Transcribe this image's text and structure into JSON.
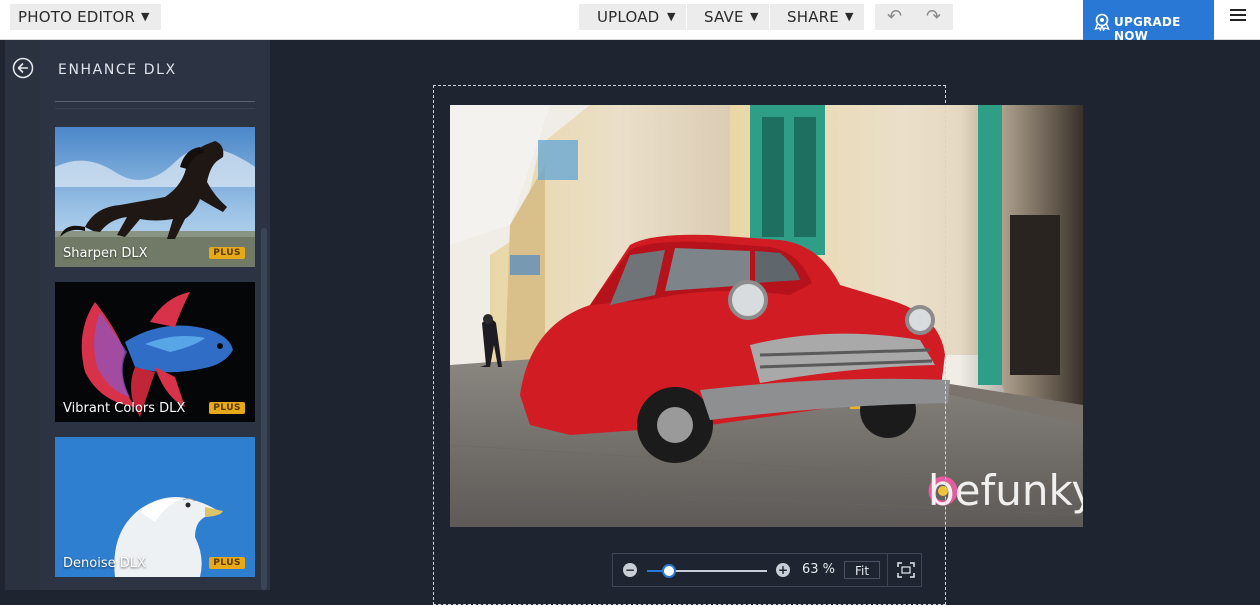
{
  "topbar": {
    "app_menu_label": "PHOTO EDITOR",
    "upload_label": "UPLOAD",
    "save_label": "SAVE",
    "share_label": "SHARE",
    "upgrade_label": "UPGRADE NOW",
    "undo_icon": "undo-icon",
    "redo_icon": "redo-icon"
  },
  "panel": {
    "title": "ENHANCE DLX",
    "back_icon": "back-arrow-icon",
    "cards": [
      {
        "label": "Sharpen DLX",
        "badge": "PLUS"
      },
      {
        "label": "Vibrant Colors DLX",
        "badge": "PLUS"
      },
      {
        "label": "Denoise DLX",
        "badge": "PLUS"
      }
    ]
  },
  "canvas": {
    "watermark": "befunky"
  },
  "zoom": {
    "percent_label": "63 %",
    "fraction": 0.18,
    "fit_label": "Fit"
  },
  "colors": {
    "accent": "#2a78d6",
    "plus_badge": "#e5a91a",
    "panel_bg": "#2c3443",
    "canvas_bg": "#1f2530"
  }
}
